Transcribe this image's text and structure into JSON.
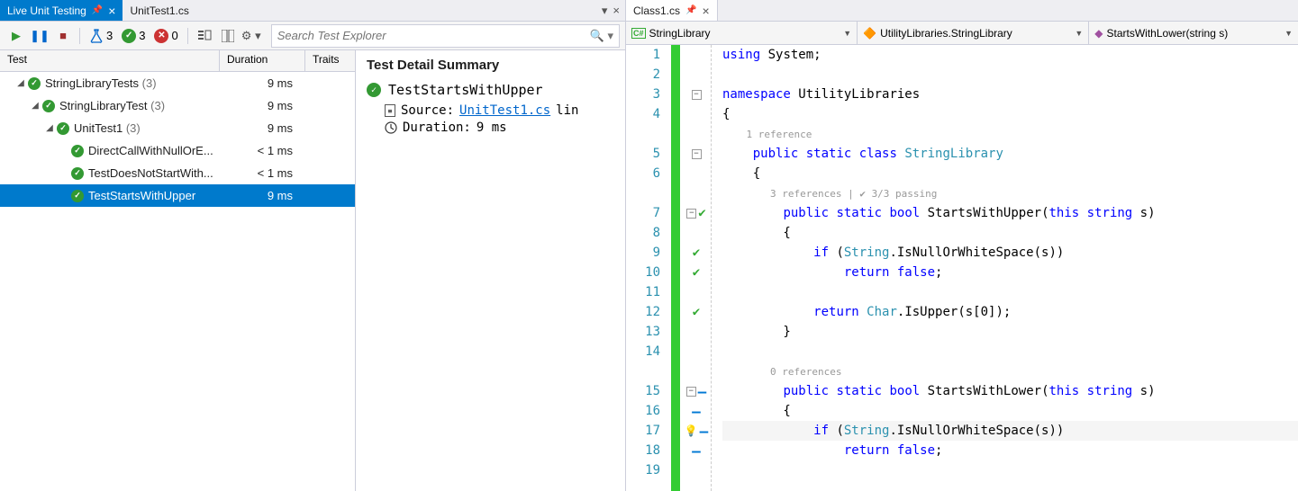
{
  "tabs_left": [
    {
      "label": "Live Unit Testing",
      "pinned": true
    },
    {
      "label": "UnitTest1.cs"
    }
  ],
  "toolbar": {
    "flask_count": "3",
    "pass_count": "3",
    "fail_count": "0",
    "search_placeholder": "Search Test Explorer"
  },
  "tree": {
    "headers": {
      "test": "Test",
      "duration": "Duration",
      "traits": "Traits"
    },
    "rows": [
      {
        "indent": 1,
        "exp": true,
        "icon": "pass",
        "name": "StringLibraryTests",
        "count": "(3)",
        "dur": "9 ms"
      },
      {
        "indent": 2,
        "exp": true,
        "icon": "pass",
        "name": "StringLibraryTest",
        "count": "(3)",
        "dur": "9 ms"
      },
      {
        "indent": 3,
        "exp": true,
        "icon": "pass",
        "name": "UnitTest1",
        "count": "(3)",
        "dur": "9 ms"
      },
      {
        "indent": 4,
        "exp": false,
        "icon": "pass",
        "name": "DirectCallWithNullOrE...",
        "count": "",
        "dur": "< 1 ms"
      },
      {
        "indent": 4,
        "exp": false,
        "icon": "pass",
        "name": "TestDoesNotStartWith...",
        "count": "",
        "dur": "< 1 ms"
      },
      {
        "indent": 4,
        "exp": false,
        "icon": "pass",
        "name": "TestStartsWithUpper",
        "count": "",
        "dur": "9 ms",
        "selected": true
      }
    ]
  },
  "detail": {
    "title": "Test Detail Summary",
    "test_name": "TestStartsWithUpper",
    "source_label": "Source:",
    "source_link": "UnitTest1.cs",
    "source_suffix": "lin",
    "duration_label": "Duration:",
    "duration_value": "9 ms"
  },
  "tabs_right": [
    {
      "label": "Class1.cs"
    }
  ],
  "nav": {
    "scope": "StringLibrary",
    "class": "UtilityLibraries.StringLibrary",
    "member": "StartsWithLower(string s)"
  },
  "code": {
    "lines": [
      {
        "n": 1,
        "marks": [],
        "tokens": [
          [
            "kw",
            "using"
          ],
          [
            "",
            " "
          ],
          [
            "",
            "System"
          ],
          [
            "",
            ";"
          ]
        ]
      },
      {
        "n": 2,
        "marks": [],
        "tokens": []
      },
      {
        "n": 3,
        "marks": [
          "fold"
        ],
        "tokens": [
          [
            "kw",
            "namespace"
          ],
          [
            "",
            " "
          ],
          [
            "",
            "UtilityLibraries"
          ]
        ]
      },
      {
        "n": 4,
        "marks": [],
        "tokens": [
          [
            "",
            "{"
          ]
        ]
      },
      {
        "hint": true,
        "text": "1 reference",
        "indent": "    "
      },
      {
        "n": 5,
        "marks": [
          "fold"
        ],
        "tokens": [
          [
            "",
            "    "
          ],
          [
            "kw",
            "public"
          ],
          [
            "",
            " "
          ],
          [
            "kw",
            "static"
          ],
          [
            "",
            " "
          ],
          [
            "kw",
            "class"
          ],
          [
            "",
            " "
          ],
          [
            "type",
            "StringLibrary"
          ]
        ]
      },
      {
        "n": 6,
        "marks": [],
        "tokens": [
          [
            "",
            "    {"
          ]
        ]
      },
      {
        "hint": true,
        "text": "3 references | ✔ 3/3 passing",
        "indent": "        "
      },
      {
        "n": 7,
        "marks": [
          "fold",
          "chk"
        ],
        "tokens": [
          [
            "",
            "        "
          ],
          [
            "kw",
            "public"
          ],
          [
            "",
            " "
          ],
          [
            "kw",
            "static"
          ],
          [
            "",
            " "
          ],
          [
            "kw",
            "bool"
          ],
          [
            "",
            " "
          ],
          [
            "",
            "StartsWithUpper"
          ],
          [
            "",
            "("
          ],
          [
            "kw",
            "this"
          ],
          [
            "",
            " "
          ],
          [
            "kw",
            "string"
          ],
          [
            "",
            " s)"
          ]
        ]
      },
      {
        "n": 8,
        "marks": [],
        "tokens": [
          [
            "",
            "        {"
          ]
        ]
      },
      {
        "n": 9,
        "marks": [
          "chk"
        ],
        "tokens": [
          [
            "",
            "            "
          ],
          [
            "kw",
            "if"
          ],
          [
            "",
            " ("
          ],
          [
            "type",
            "String"
          ],
          [
            "",
            ".IsNullOrWhiteSpace(s))"
          ]
        ]
      },
      {
        "n": 10,
        "marks": [
          "chk"
        ],
        "tokens": [
          [
            "",
            "                "
          ],
          [
            "kw",
            "return"
          ],
          [
            "",
            " "
          ],
          [
            "kw",
            "false"
          ],
          [
            "",
            ";"
          ]
        ]
      },
      {
        "n": 11,
        "marks": [],
        "tokens": []
      },
      {
        "n": 12,
        "marks": [
          "chk"
        ],
        "tokens": [
          [
            "",
            "            "
          ],
          [
            "kw",
            "return"
          ],
          [
            "",
            " "
          ],
          [
            "type",
            "Char"
          ],
          [
            "",
            ".IsUpper(s["
          ],
          [
            "num",
            "0"
          ],
          [
            "",
            "]);"
          ]
        ]
      },
      {
        "n": 13,
        "marks": [],
        "tokens": [
          [
            "",
            "        }"
          ]
        ]
      },
      {
        "n": 14,
        "marks": [],
        "tokens": []
      },
      {
        "hint": true,
        "text": "0 references",
        "indent": "        "
      },
      {
        "n": 15,
        "marks": [
          "fold",
          "dash"
        ],
        "tokens": [
          [
            "",
            "        "
          ],
          [
            "kw",
            "public"
          ],
          [
            "",
            " "
          ],
          [
            "kw",
            "static"
          ],
          [
            "",
            " "
          ],
          [
            "kw",
            "bool"
          ],
          [
            "",
            " "
          ],
          [
            "",
            "StartsWithLower"
          ],
          [
            "",
            "("
          ],
          [
            "kw",
            "this"
          ],
          [
            "",
            " "
          ],
          [
            "kw",
            "string"
          ],
          [
            "",
            " s)"
          ]
        ]
      },
      {
        "n": 16,
        "marks": [
          "dash"
        ],
        "tokens": [
          [
            "",
            "        {"
          ]
        ]
      },
      {
        "n": 17,
        "marks": [
          "bulb",
          "dash"
        ],
        "cursor": true,
        "tokens": [
          [
            "",
            "            "
          ],
          [
            "kw",
            "if"
          ],
          [
            "",
            " ("
          ],
          [
            "type",
            "String"
          ],
          [
            "",
            ".IsNullOrWhiteSpace(s))"
          ]
        ]
      },
      {
        "n": 18,
        "marks": [
          "dash"
        ],
        "tokens": [
          [
            "",
            "                "
          ],
          [
            "kw",
            "return"
          ],
          [
            "",
            " "
          ],
          [
            "kw",
            "false"
          ],
          [
            "",
            ";"
          ]
        ]
      },
      {
        "n": 19,
        "marks": [],
        "tokens": []
      }
    ]
  }
}
